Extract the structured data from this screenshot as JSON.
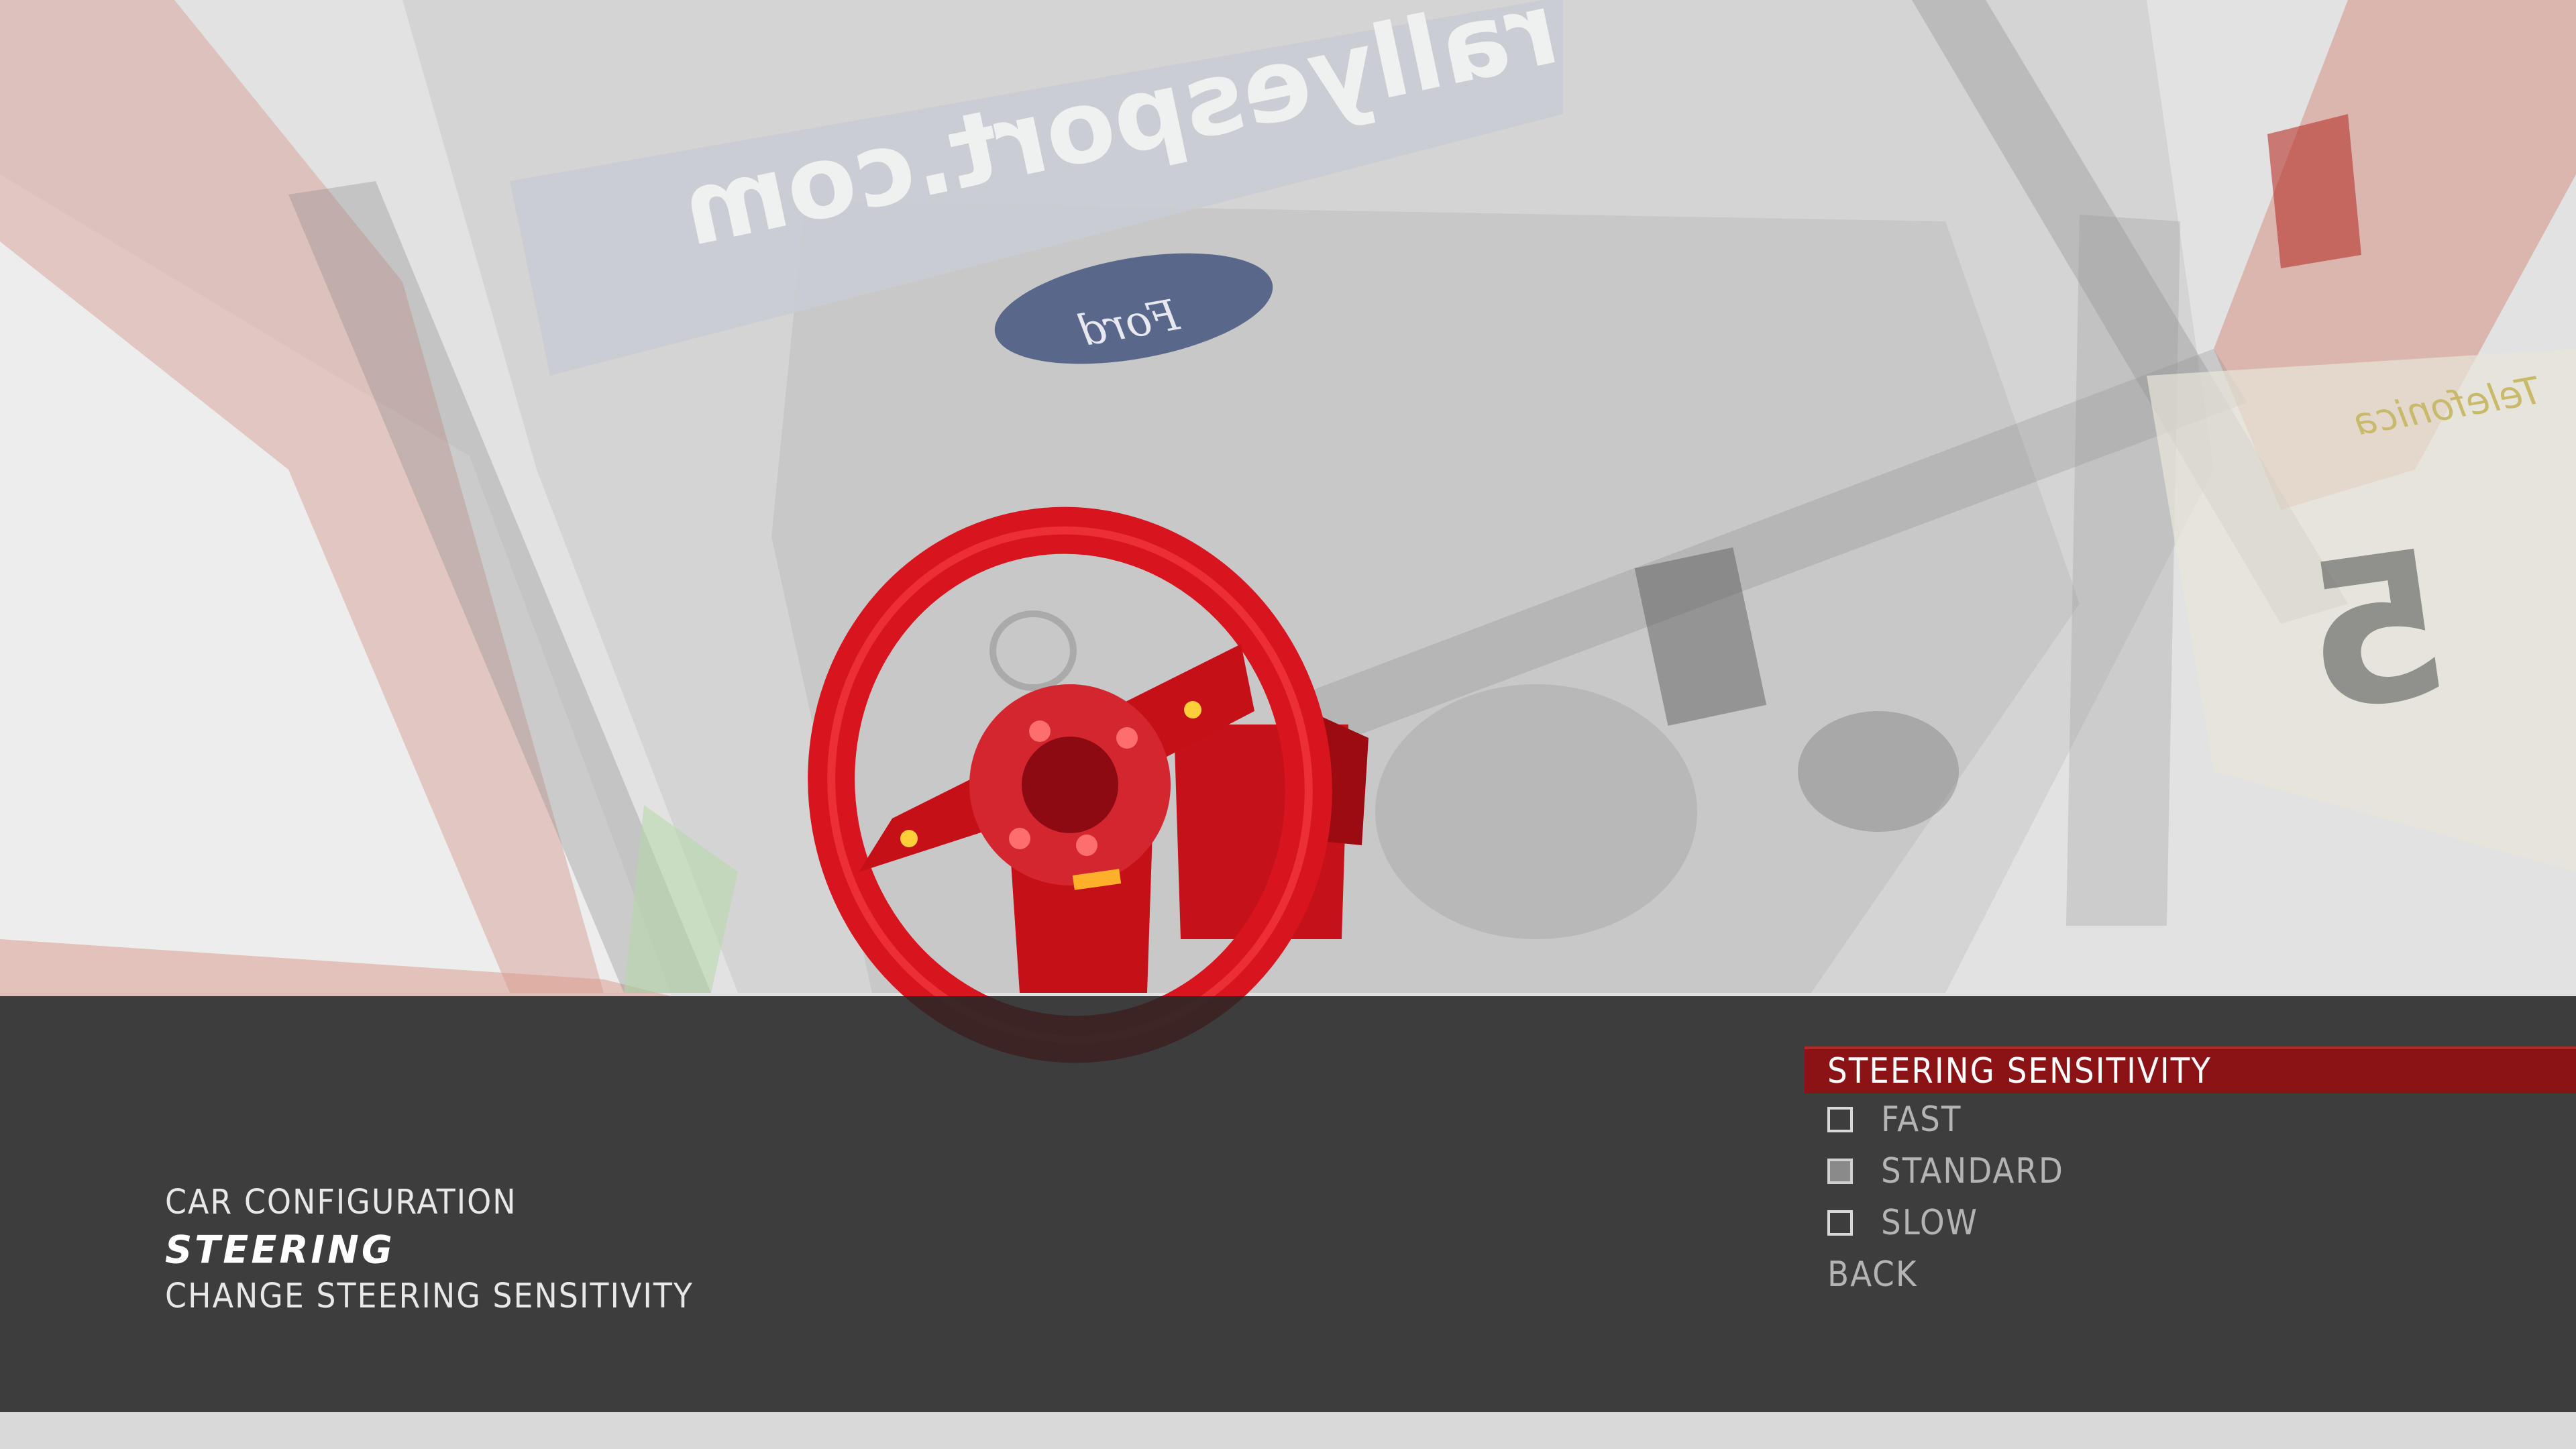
{
  "screen_info": {
    "section": "CAR CONFIGURATION",
    "title": "STEERING",
    "subtitle": "CHANGE STEERING SENSITIVITY"
  },
  "steering_menu": {
    "header": "STEERING SENSITIVITY",
    "options": [
      {
        "label": "FAST",
        "selected": false
      },
      {
        "label": "STANDARD",
        "selected": true
      },
      {
        "label": "SLOW",
        "selected": false
      }
    ],
    "back_label": "BACK"
  },
  "scene": {
    "banner_text": "rallyesport.com",
    "badge_text": "Ford",
    "sponsor_text": "Telefonica",
    "number_plate": "5",
    "colors": {
      "wheel_red": "#d8141e",
      "hud_band": "#262626",
      "menu_header": "#8b1316",
      "text_light": "#e8e8e8",
      "text_dim": "#b4b4b4"
    }
  }
}
